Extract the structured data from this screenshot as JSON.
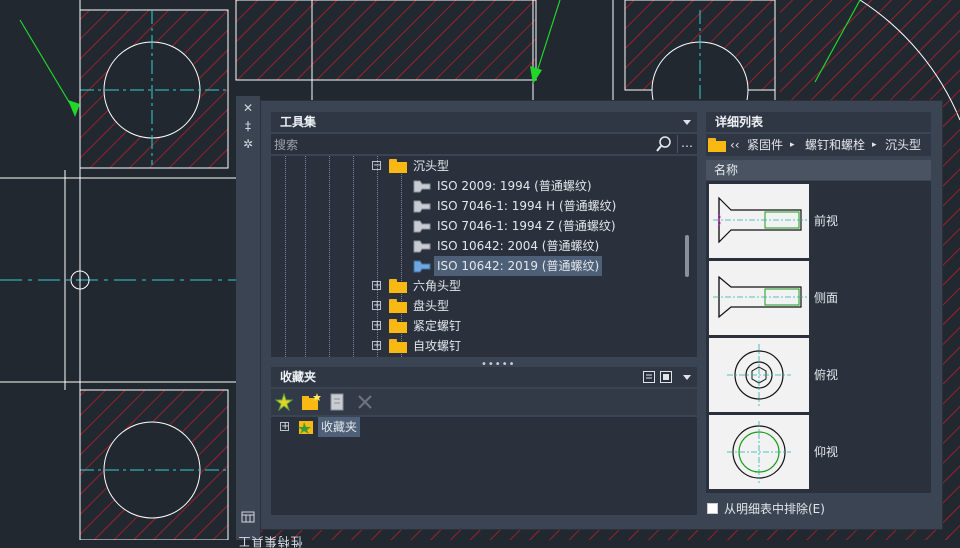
{
  "palette": {
    "title": "工具集特性",
    "close_label": "✕",
    "autohide_label": "‡",
    "settings_label": "✲"
  },
  "tools": {
    "header": "工具集",
    "search_placeholder": "搜索",
    "more_label": "…",
    "tree": [
      {
        "label": "沉头型",
        "type": "folder",
        "expander": "−"
      },
      {
        "label": "ISO 2009: 1994 (普通螺纹)",
        "type": "item",
        "selected": false
      },
      {
        "label": "ISO 7046-1: 1994 H  (普通螺纹)",
        "type": "item",
        "selected": false
      },
      {
        "label": "ISO 7046-1: 1994 Z  (普通螺纹)",
        "type": "item",
        "selected": false
      },
      {
        "label": "ISO 10642: 2004 (普通螺纹)",
        "type": "item",
        "selected": false
      },
      {
        "label": "ISO 10642: 2019 (普通螺纹)",
        "type": "item",
        "selected": true
      },
      {
        "label": "六角头型",
        "type": "folder",
        "expander": "+"
      },
      {
        "label": "盘头型",
        "type": "folder",
        "expander": "+"
      },
      {
        "label": "紧定螺钉",
        "type": "folder",
        "expander": "+"
      },
      {
        "label": "自攻螺钉",
        "type": "folder",
        "expander": "+"
      }
    ],
    "grip": "•••••"
  },
  "favorites": {
    "header": "收藏夹",
    "root": {
      "label": "收藏夹",
      "expander": "+"
    }
  },
  "detail": {
    "header": "详细列表",
    "breadcrumb": {
      "back": "‹‹",
      "items": [
        "紧固件",
        "螺钉和螺栓",
        "沉头型"
      ],
      "separator": "▸"
    },
    "column": "名称",
    "views": [
      {
        "label": "前视"
      },
      {
        "label": "侧面"
      },
      {
        "label": "俯视"
      },
      {
        "label": "仰视"
      }
    ],
    "exclude_label": "从明细表中排除(E)"
  },
  "colors": {
    "panel": "#3b4453",
    "header": "#2f3744",
    "tree_bg": "#2a313d",
    "selection": "#4d6078",
    "folder": "#f8b912",
    "drawing_bg": "#212830",
    "hatch": "#c81e2a"
  }
}
